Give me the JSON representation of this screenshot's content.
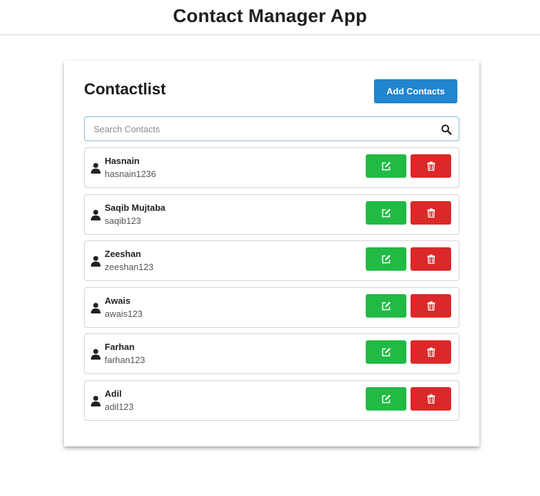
{
  "header": {
    "title": "Contact Manager App"
  },
  "card": {
    "title": "Contactlist",
    "add_button_label": "Add Contacts"
  },
  "search": {
    "placeholder": "Search Contacts",
    "value": ""
  },
  "contacts": [
    {
      "name": "Hasnain",
      "email": "hasnain1236"
    },
    {
      "name": "Saqib Mujtaba",
      "email": "saqib123"
    },
    {
      "name": "Zeeshan",
      "email": "zeeshan123"
    },
    {
      "name": "Awais",
      "email": "awais123"
    },
    {
      "name": "Farhan",
      "email": "farhan123"
    },
    {
      "name": "Adil",
      "email": "adil123"
    }
  ],
  "icons": {
    "search": "search-icon",
    "user": "user-icon",
    "edit": "edit-icon",
    "delete": "trash-icon"
  },
  "colors": {
    "primary": "#2185d0",
    "edit": "#21ba45",
    "delete": "#db2828"
  }
}
